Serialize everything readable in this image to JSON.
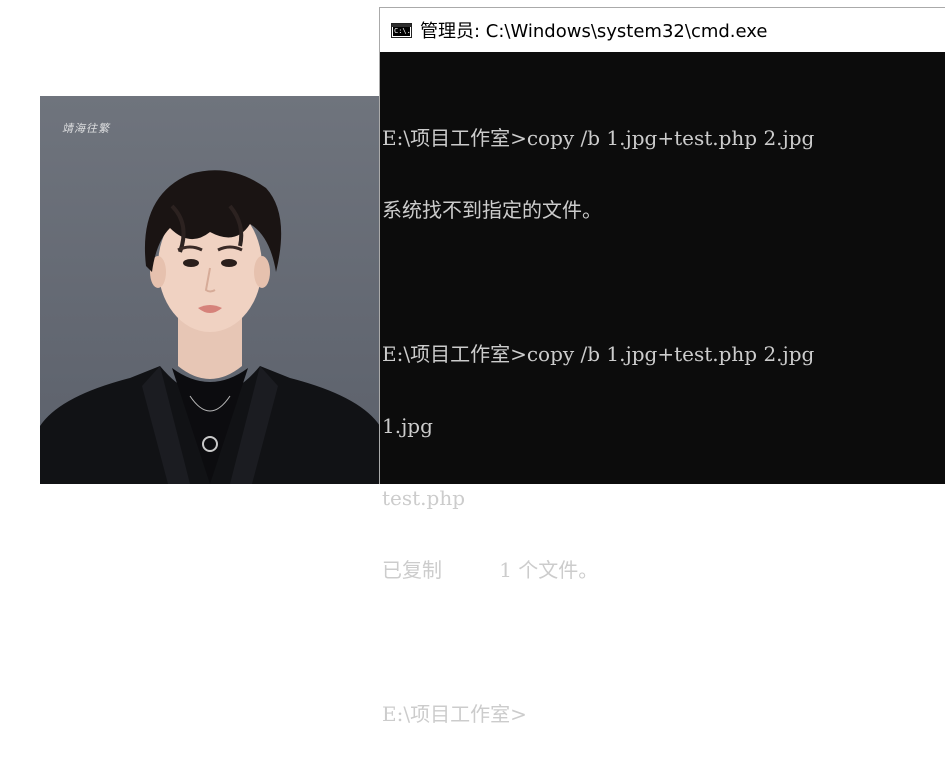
{
  "photo": {
    "watermark": "靖海往繁"
  },
  "window": {
    "title": "管理员: C:\\Windows\\system32\\cmd.exe",
    "icon": "cmd-icon",
    "icon_glyph": "C:\\."
  },
  "console": {
    "lines": [
      "E:\\项目工作室>copy /b 1.jpg+test.php 2.jpg",
      "系统找不到指定的文件。",
      "",
      "E:\\项目工作室>copy /b 1.jpg+test.php 2.jpg",
      "1.jpg",
      "test.php",
      "已复制         1 个文件。",
      "",
      "E:\\项目工作室>"
    ]
  },
  "colors": {
    "console_bg": "#0c0c0c",
    "console_text": "#cccccc",
    "titlebar_bg": "#ffffff"
  }
}
